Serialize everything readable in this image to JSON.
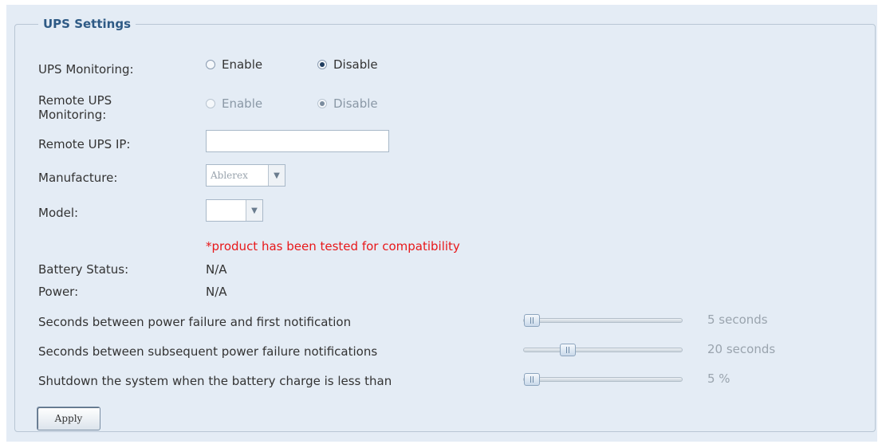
{
  "section_title": "UPS Settings",
  "ups_monitoring": {
    "label": "UPS Monitoring:",
    "enable": "Enable",
    "disable": "Disable",
    "selected": "disable"
  },
  "remote_ups_monitoring": {
    "label_line1": "Remote UPS",
    "label_line2": "Monitoring:",
    "enable": "Enable",
    "disable": "Disable",
    "selected": "disable",
    "enabled": false
  },
  "remote_ups_ip": {
    "label": "Remote UPS IP:",
    "value": ""
  },
  "manufacture": {
    "label": "Manufacture:",
    "value": "Ablerex"
  },
  "model": {
    "label": "Model:",
    "value": ""
  },
  "compat_note": "*product has been tested for compatibility",
  "battery_status": {
    "label": "Battery Status:",
    "value": "N/A"
  },
  "power": {
    "label": "Power:",
    "value": "N/A"
  },
  "sliders": [
    {
      "label": "Seconds between power failure and first notification",
      "value_text": "5 seconds",
      "position": 0.0
    },
    {
      "label": "Seconds between subsequent power failure notifications",
      "value_text": "20 seconds",
      "position": 0.25
    },
    {
      "label": "Shutdown the system when the battery charge is less than",
      "value_text": "5 %",
      "position": 0.0
    }
  ],
  "apply_label": "Apply",
  "colors": {
    "accent": "#2e5a85",
    "note": "#e8181a",
    "panel_bg": "#e4ecf5"
  }
}
